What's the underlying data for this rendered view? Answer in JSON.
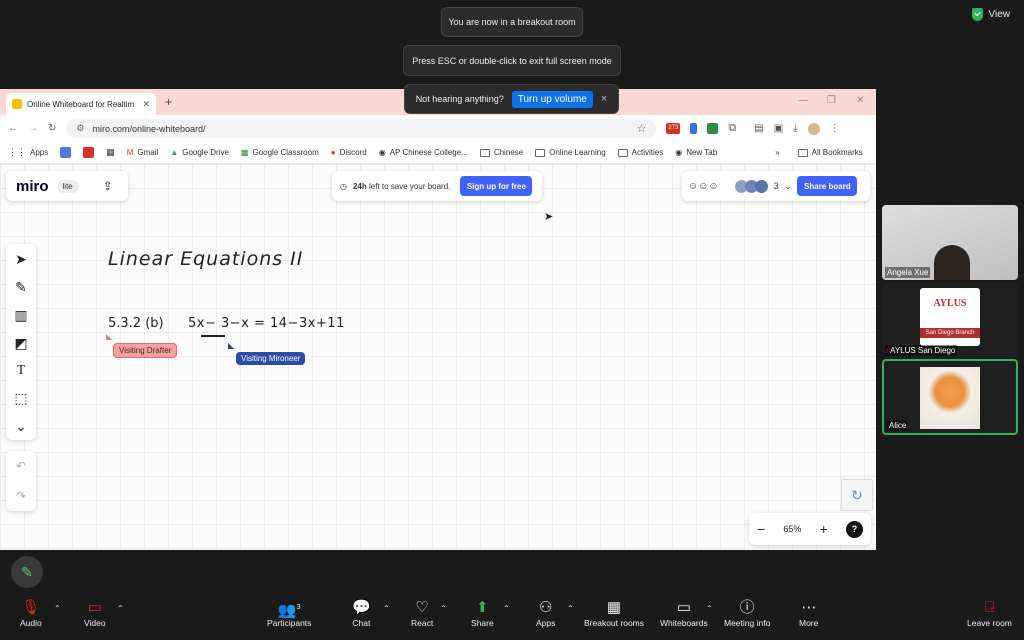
{
  "notifications": {
    "breakout": "You are now in a breakout room",
    "fullscreen": "Press ESC or double-click to exit full screen mode",
    "audio_prompt": "Not hearing anything?",
    "audio_button": "Turn up volume",
    "close": "×"
  },
  "view_label": "View",
  "browser": {
    "tab_title": "Online Whiteboard for Realtim",
    "new_tab": "+",
    "url": "miro.com/online-whiteboard/",
    "bookmarks": [
      "Apps",
      "Gmail",
      "Google Drive",
      "Google Classroom",
      "Discord",
      "AP Chinese College...",
      "Chinese",
      "Online Learning",
      "Activities",
      "New Tab"
    ],
    "all_bookmarks": "All Bookmarks",
    "ext_badge": "273"
  },
  "miro": {
    "logo": "miro",
    "plan": "lite",
    "save_prefix": "24h",
    "save_suffix": " left to save your board.",
    "signup": "Sign up for free",
    "collab_count": "3",
    "share": "Share board",
    "zoom": "65%",
    "zoom_minus": "−",
    "zoom_plus": "+",
    "help": "?"
  },
  "board": {
    "title": "Linear Equations II",
    "problem_label": "5.3.2 (b)",
    "equation": "5x− 3−x = 14−3x+11",
    "cursor1": "Visiting Drafter",
    "cursor2": "Visiting Mironeer"
  },
  "participants": [
    {
      "name": "Angela Xue"
    },
    {
      "name": "AYLUS San Diego"
    },
    {
      "name": "Alice"
    }
  ],
  "aylus_logo": {
    "title": "AYLUS",
    "branch": "San Diego Branch"
  },
  "toolbar": {
    "audio": "Audio",
    "video": "Video",
    "participants": "Participants",
    "participants_count": "3",
    "chat": "Chat",
    "react": "React",
    "share": "Share",
    "apps": "Apps",
    "breakout": "Breakout rooms",
    "whiteboards": "Whiteboards",
    "meeting_info": "Meeting info",
    "more": "More",
    "leave": "Leave room"
  },
  "colors": {
    "miro_blue": "#4262ff",
    "zoom_green": "#2fb35c",
    "leave_red": "#e02828"
  }
}
